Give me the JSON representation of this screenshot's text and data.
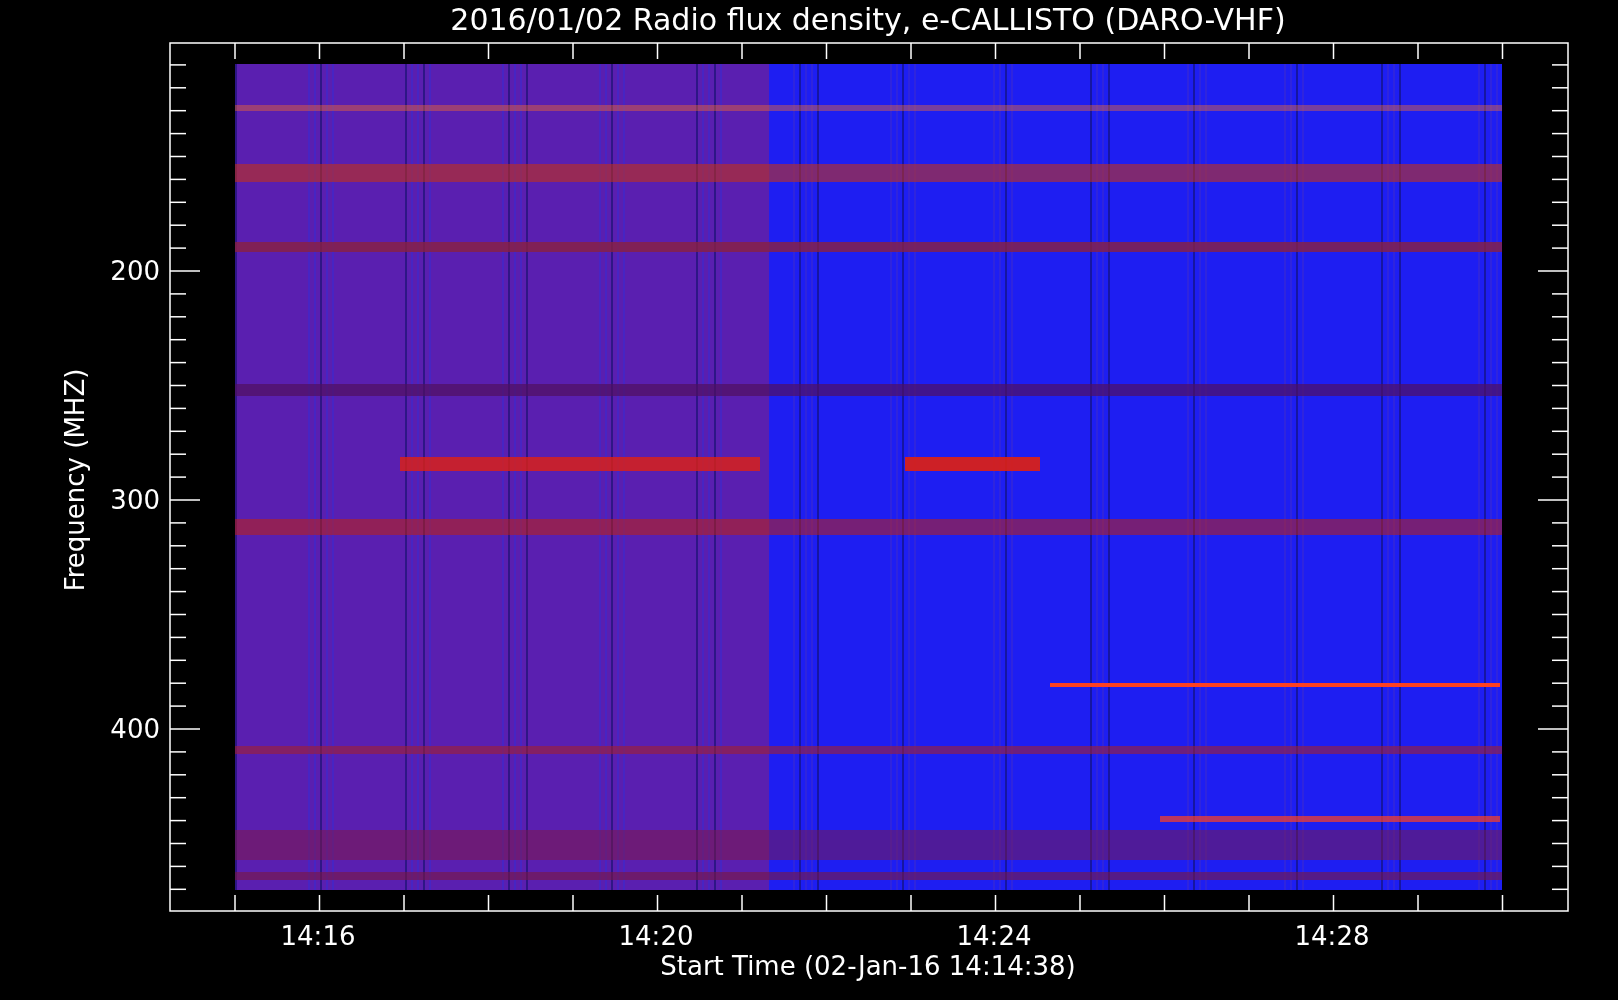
{
  "title": "2016/01/02  Radio flux density, e-CALLISTO (DARO-VHF)",
  "y_axis": {
    "label": "Frequency (MHZ)",
    "ticks": [
      "200",
      "300",
      "400"
    ]
  },
  "x_axis": {
    "label": "Start Time (02-Jan-16 14:14:38)",
    "ticks": [
      "14:16",
      "14:20",
      "14:24",
      "14:28"
    ]
  }
}
